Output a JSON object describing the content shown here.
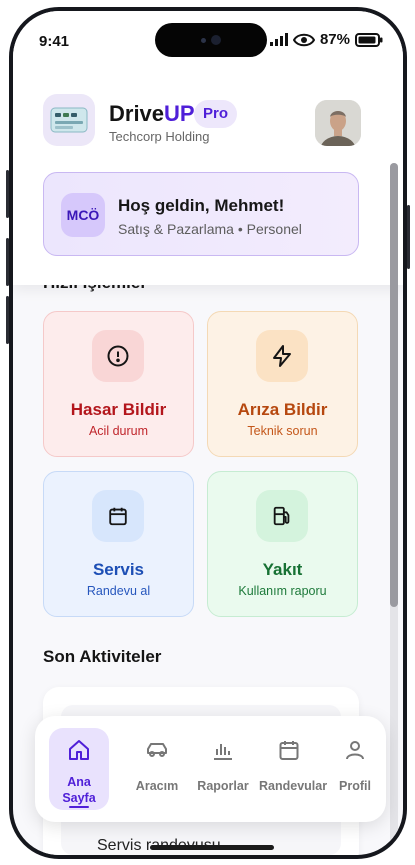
{
  "status_bar": {
    "time": "9:41",
    "battery": "87%"
  },
  "header": {
    "brand_main": "Drive",
    "brand_accent": "UP",
    "badge": "Pro",
    "company": "Techcorp Holding"
  },
  "welcome": {
    "initials": "MCÖ",
    "title": "Hoş geldin, Mehmet!",
    "subtitle": "Satış & Pazarlama • Personel"
  },
  "quick_actions": {
    "title": "Hızlı İşlemler",
    "items": [
      {
        "title": "Hasar Bildir",
        "subtitle": "Acil durum",
        "icon": "alert-circle-icon",
        "color": "#b3161c"
      },
      {
        "title": "Arıza Bildir",
        "subtitle": "Teknik sorun",
        "icon": "lightning-icon",
        "color": "#b6480f"
      },
      {
        "title": "Servis",
        "subtitle": "Randevu al",
        "icon": "calendar-icon",
        "color": "#1d4fb5"
      },
      {
        "title": "Yakıt",
        "subtitle": "Kullanım raporu",
        "icon": "fuel-icon",
        "color": "#177134"
      }
    ]
  },
  "recent": {
    "title": "Son Aktiviteler",
    "items": [
      {
        "title": "Servis randevusu"
      }
    ]
  },
  "tabbar": {
    "items": [
      {
        "label": "Ana Sayfa",
        "icon": "home-icon",
        "active": true
      },
      {
        "label": "Aracım",
        "icon": "car-icon",
        "active": false
      },
      {
        "label": "Raporlar",
        "icon": "bar-chart-icon",
        "active": false
      },
      {
        "label": "Randevular",
        "icon": "calendar-icon",
        "active": false
      },
      {
        "label": "Profil",
        "icon": "user-icon",
        "active": false
      }
    ]
  },
  "colors": {
    "accent": "#4f1fd8",
    "accent_light": "#ede7fb"
  }
}
